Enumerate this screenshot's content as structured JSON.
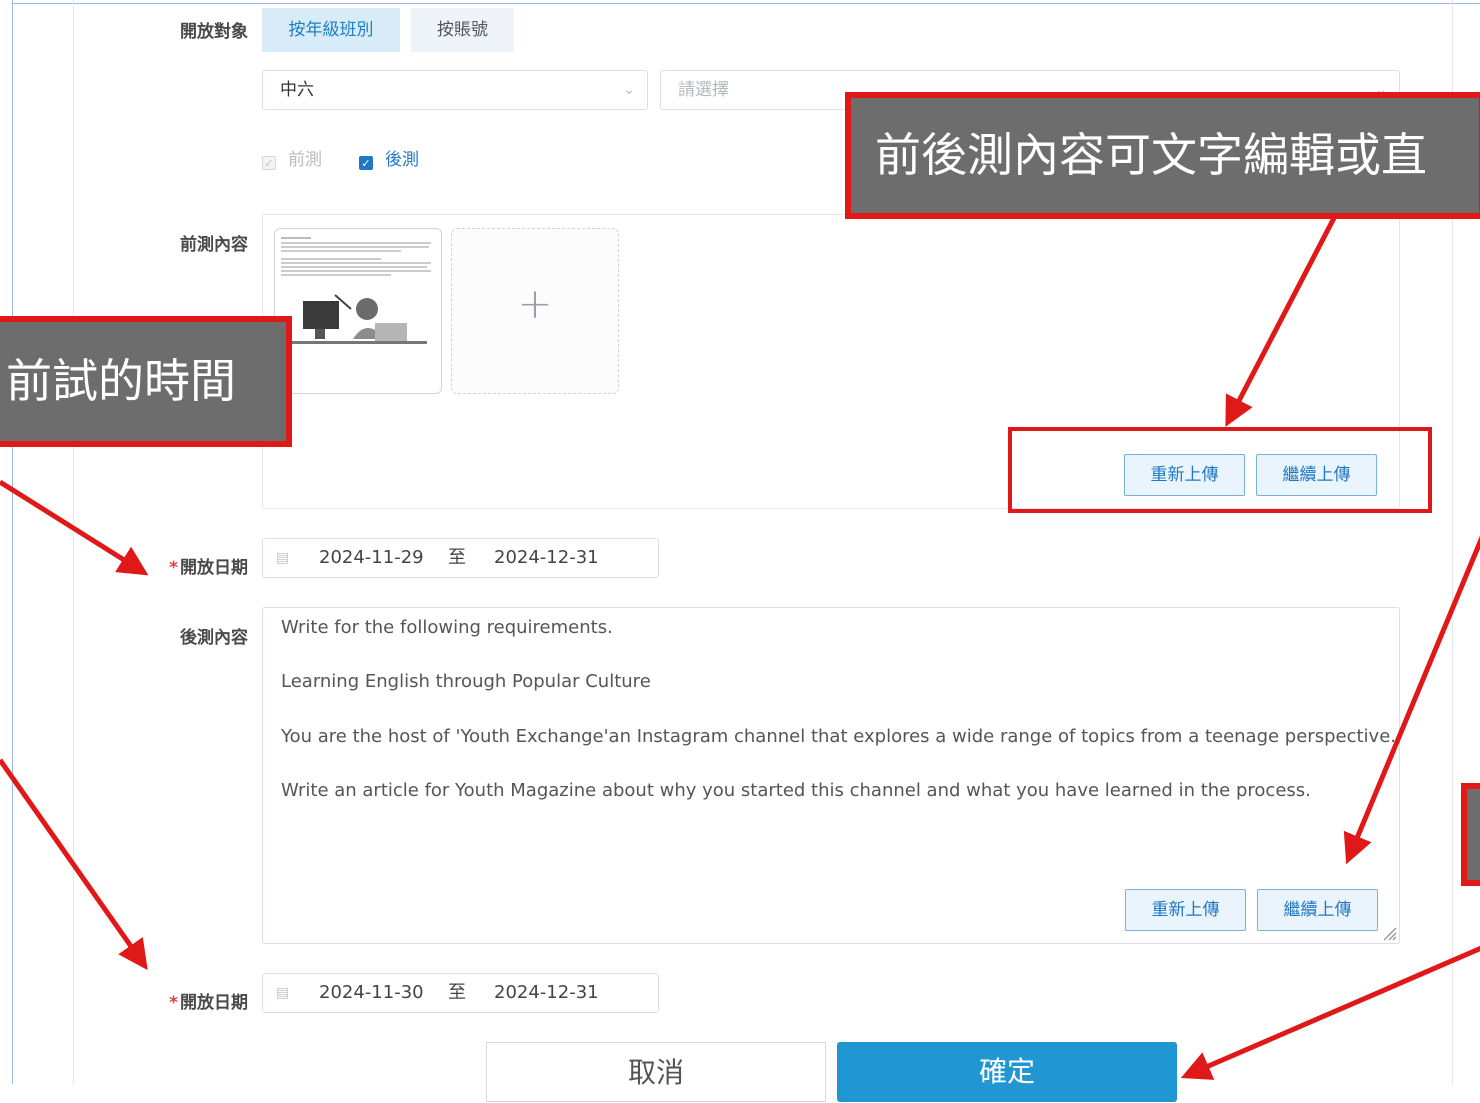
{
  "form": {
    "audience_label": "開放對象",
    "audience_tabs": [
      {
        "label": "按年級班別",
        "active": true
      },
      {
        "label": "按賬號",
        "active": false
      }
    ],
    "grade_select": {
      "value": "中六"
    },
    "class_select": {
      "placeholder": "請選擇"
    },
    "checks": [
      {
        "label": "前測",
        "checked": true,
        "disabled": true
      },
      {
        "label": "後測",
        "checked": true,
        "disabled": false
      }
    ],
    "pre_content_label": "前測內容",
    "pre_upload_buttons": {
      "reupload": "重新上傳",
      "continue": "繼續上傳"
    },
    "pre_date": {
      "label": "開放日期",
      "start": "2024-11-29",
      "sep": "至",
      "end": "2024-12-31"
    },
    "post_content_label": "後測內容",
    "post_content_lines": [
      "Write for the following requirements.",
      "Learning English through Popular Culture",
      "You are the host of 'Youth Exchange'an Instagram channel that explores a wide range of topics from a teenage perspective.",
      "Write an article for Youth Magazine about why you started this channel and what you have learned in the process."
    ],
    "post_upload_buttons": {
      "reupload": "重新上傳",
      "continue": "繼續上傳"
    },
    "post_date": {
      "label": "開放日期",
      "start": "2024-11-30",
      "sep": "至",
      "end": "2024-12-31"
    },
    "cancel_label": "取消",
    "confirm_label": "確定"
  },
  "annotations": {
    "top_callout": "前後測內容可文字編輯或直",
    "left_callout": "前試的時間"
  },
  "colors": {
    "accent": "#1f77c6",
    "annotation_red": "#e11818",
    "annotation_bg": "#6d6d6d"
  }
}
